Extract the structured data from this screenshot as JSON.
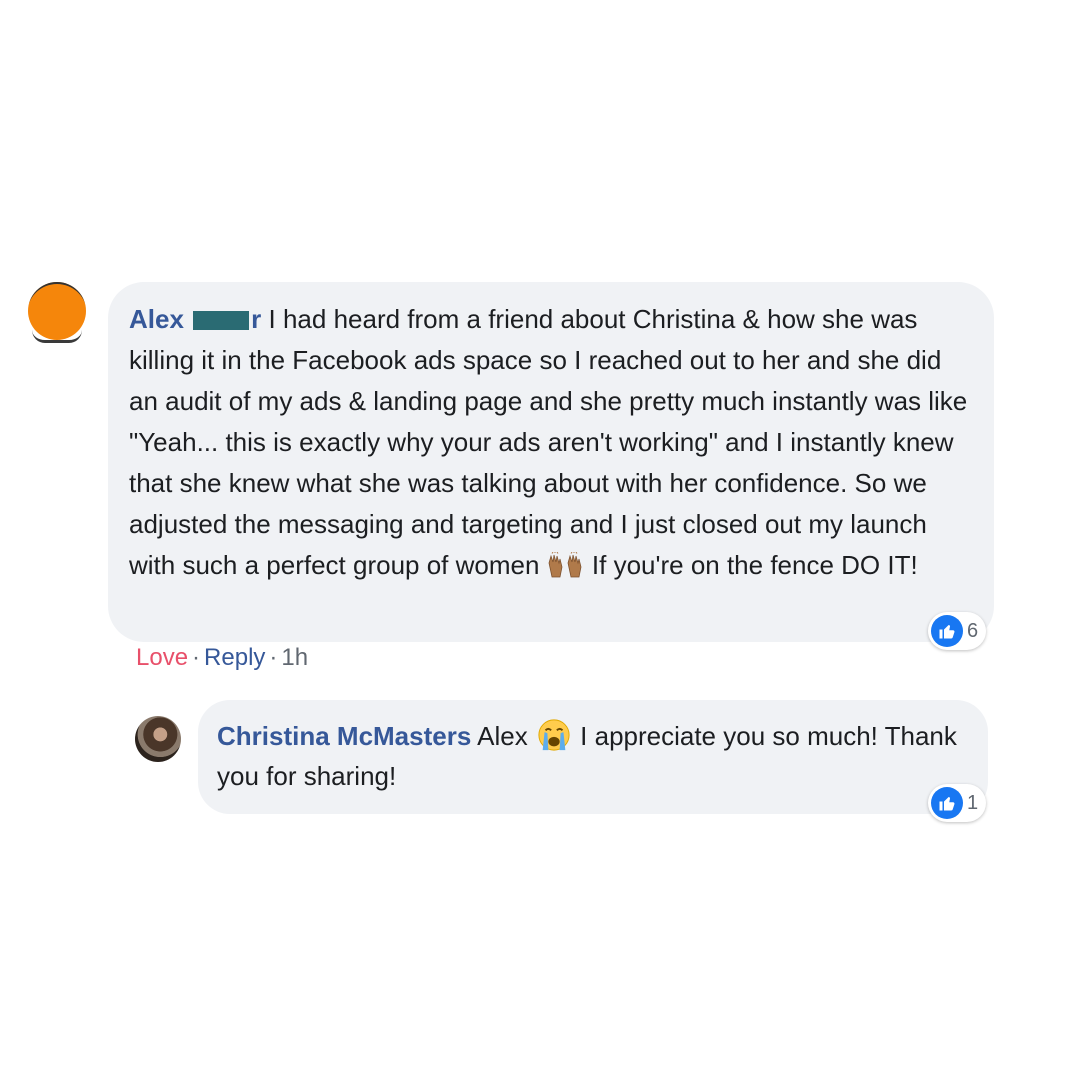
{
  "comment": {
    "author": "Alex",
    "author_suffix": "r",
    "text_before_emoji": "I had heard from a friend about Christina & how she was killing it in the Facebook ads space so I reached out to her and she did an audit of my ads & landing page and she pretty much instantly was like \"Yeah... this is exactly why your ads aren't working\" and I instantly knew that she knew what she was talking about with her confidence. So we adjusted the messaging and targeting and I just closed out my launch with such a perfect group of women",
    "text_after_emoji": "If you're on the fence DO IT!",
    "emoji": "raising-hands-emoji",
    "reaction_count": "6",
    "actions": {
      "love": "Love",
      "separator": "·",
      "reply": "Reply",
      "time": "1h"
    }
  },
  "reply": {
    "author": "Christina McMasters",
    "text_before_emoji": "Alex",
    "emoji": "crying-face-emoji",
    "text_after_emoji": "I appreciate you so much! Thank you for sharing!",
    "reaction_count": "1"
  },
  "colors": {
    "author_link": "#365899",
    "love_action": "#e8506a",
    "bubble_bg": "#f0f2f5",
    "like_blue": "#1877f2",
    "avatar_orange": "#f5860b",
    "redaction": "#2a6b73"
  }
}
